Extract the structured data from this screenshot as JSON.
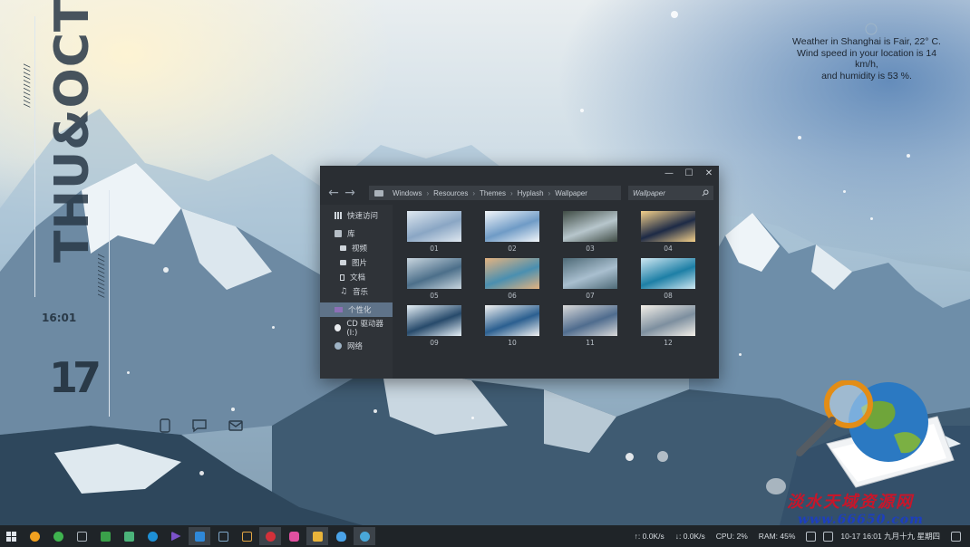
{
  "widget": {
    "day_month": "THU&OCT",
    "time": "16:01",
    "day": "17",
    "icons": [
      "phone-icon",
      "chat-bubble-icon",
      "mail-icon"
    ]
  },
  "weather": {
    "line1": "Weather in Shanghai is Fair, 22° C.",
    "line2": "Wind speed in your location is 14 km/h,",
    "line3": "and humidity is 53 %."
  },
  "explorer": {
    "window_buttons": [
      "—",
      "☐",
      "✕"
    ],
    "nav_back": "←",
    "nav_forward": "→",
    "breadcrumb": [
      "Windows",
      "Resources",
      "Themes",
      "Hyplash",
      "Wallpaper"
    ],
    "breadcrumb_sep": "›",
    "search_text": "Wallpaper",
    "sidebar": {
      "quick_access": "快速访问",
      "library": "库",
      "videos": "视频",
      "pictures": "图片",
      "documents": "文档",
      "music": "音乐",
      "personalize": "个性化",
      "cd_drive": "CD 驱动器 (I:)",
      "network": "网络"
    },
    "files": [
      {
        "label": "01",
        "colors": [
          "#8aa6c4",
          "#dfe8f0"
        ]
      },
      {
        "label": "02",
        "colors": [
          "#6f9bc6",
          "#f2f6fa"
        ]
      },
      {
        "label": "03",
        "colors": [
          "#b7c6cc",
          "#3f4b44"
        ]
      },
      {
        "label": "04",
        "colors": [
          "#1d2a46",
          "#f4d08a"
        ]
      },
      {
        "label": "05",
        "colors": [
          "#4c6f8a",
          "#c9d6df"
        ]
      },
      {
        "label": "06",
        "colors": [
          "#4a8fb0",
          "#e4b380"
        ]
      },
      {
        "label": "07",
        "colors": [
          "#a9bfcf",
          "#4e6a77"
        ]
      },
      {
        "label": "08",
        "colors": [
          "#1d7fa6",
          "#cfe8f2"
        ]
      },
      {
        "label": "09",
        "colors": [
          "#274a6b",
          "#e6f0f7"
        ]
      },
      {
        "label": "10",
        "colors": [
          "#2b5f90",
          "#f1f1f1"
        ]
      },
      {
        "label": "11",
        "colors": [
          "#4f6c8e",
          "#d9d9d9"
        ]
      },
      {
        "label": "12",
        "colors": [
          "#7d8f9f",
          "#f3efe8"
        ]
      }
    ]
  },
  "watermark": {
    "line1": "淡水天域资源网",
    "line2": "www.66650.com"
  },
  "taskbar": {
    "upload": "↑: 0.0K/s",
    "download": "↓: 0.0K/s",
    "cpu": "CPU: 2%",
    "ram": "RAM: 45%",
    "datetime": "10-17  16:01  九月十九  星期四"
  },
  "colors": {
    "window_bg": "#2a2e33",
    "sidebar_selected": "#5f7389",
    "taskbar_bg": "#1f2428"
  }
}
